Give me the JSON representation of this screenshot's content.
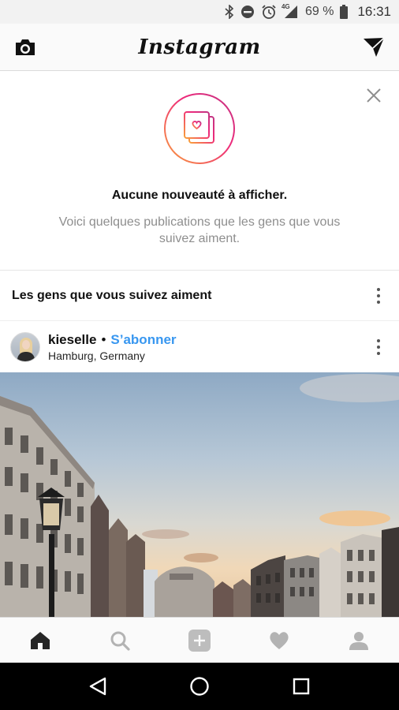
{
  "status_bar": {
    "network": "4G",
    "battery": "69 %",
    "time": "16:31",
    "icons": [
      "bluetooth-icon",
      "do-not-disturb-icon",
      "alarm-icon",
      "signal-icon",
      "battery-icon"
    ]
  },
  "top_nav": {
    "logo": "Instagram",
    "left_icon": "camera-icon",
    "right_icon": "direct-message-icon"
  },
  "notice": {
    "title": "Aucune nouveauté à afficher.",
    "subtitle": "Voici quelques publications que les gens que vous suivez aiment.",
    "close_icon": "close-icon",
    "illustration_icon": "liked-posts-icon"
  },
  "section": {
    "title": "Les gens que vous suivez aiment"
  },
  "post": {
    "username": "kieselle",
    "separator": "•",
    "follow_label": "S’abonner",
    "location": "Hamburg, Germany"
  },
  "tabbar": {
    "tabs": [
      "home-icon",
      "search-icon",
      "new-post-icon",
      "activity-heart-icon",
      "profile-icon"
    ],
    "active": "home-icon"
  },
  "colors": {
    "link_blue": "#3897f0",
    "gradient_start": "#f9a13b",
    "gradient_end": "#c13584"
  }
}
